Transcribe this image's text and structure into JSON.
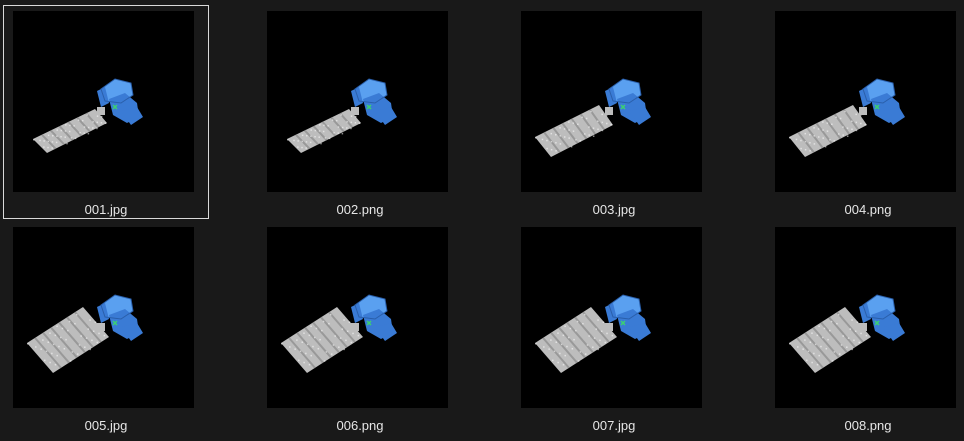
{
  "window": {
    "background": "#191919"
  },
  "selected_index": 0,
  "files": [
    {
      "name": "001.jpg",
      "variant": "narrow"
    },
    {
      "name": "002.png",
      "variant": "narrow"
    },
    {
      "name": "003.jpg",
      "variant": "medium"
    },
    {
      "name": "004.png",
      "variant": "medium"
    },
    {
      "name": "005.jpg",
      "variant": "wide"
    },
    {
      "name": "006.png",
      "variant": "wide"
    },
    {
      "name": "007.jpg",
      "variant": "wide"
    },
    {
      "name": "008.png",
      "variant": "wide"
    }
  ],
  "thumbnail": {
    "subject": "satellite-icon",
    "body_color": "#3a7bd5",
    "body_highlight": "#5aa0f0",
    "panel_color": "#bdbdbd",
    "panel_stripe": "#8a8a8a",
    "marker_color": "#3cd070",
    "backdrop_color": "#000000"
  }
}
